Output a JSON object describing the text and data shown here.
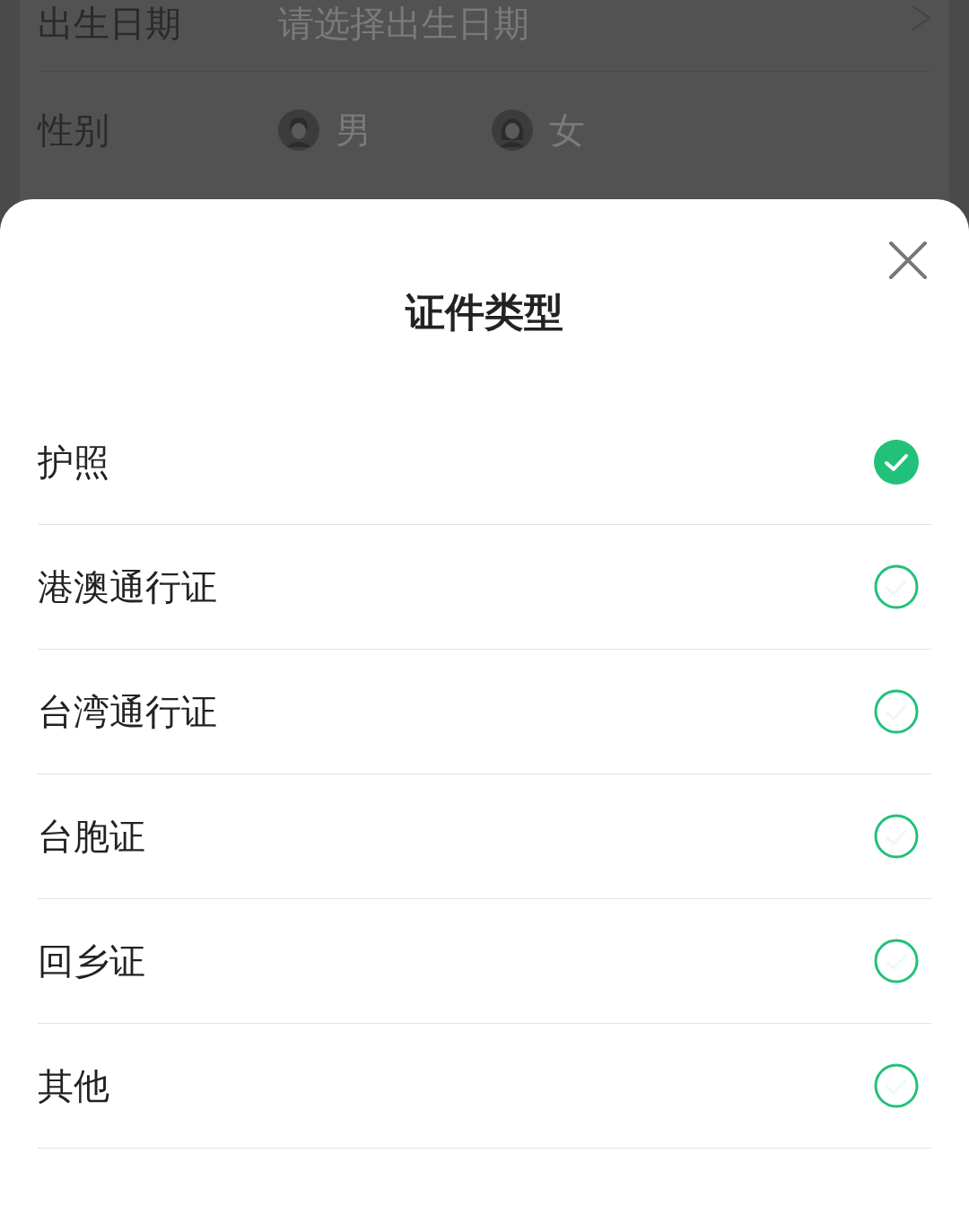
{
  "background_form": {
    "rows": [
      {
        "kind": "date",
        "label": "出生日期",
        "placeholder": "请选择出生日期"
      },
      {
        "kind": "gender",
        "label": "性别",
        "options": [
          {
            "label": "男",
            "kind": "male"
          },
          {
            "label": "女",
            "kind": "female"
          }
        ]
      }
    ]
  },
  "sheet": {
    "title": "证件类型",
    "options": [
      {
        "label": "护照",
        "selected": true
      },
      {
        "label": "港澳通行证",
        "selected": false
      },
      {
        "label": "台湾通行证",
        "selected": false
      },
      {
        "label": "台胞证",
        "selected": false
      },
      {
        "label": "回乡证",
        "selected": false
      },
      {
        "label": "其他",
        "selected": false
      }
    ]
  }
}
